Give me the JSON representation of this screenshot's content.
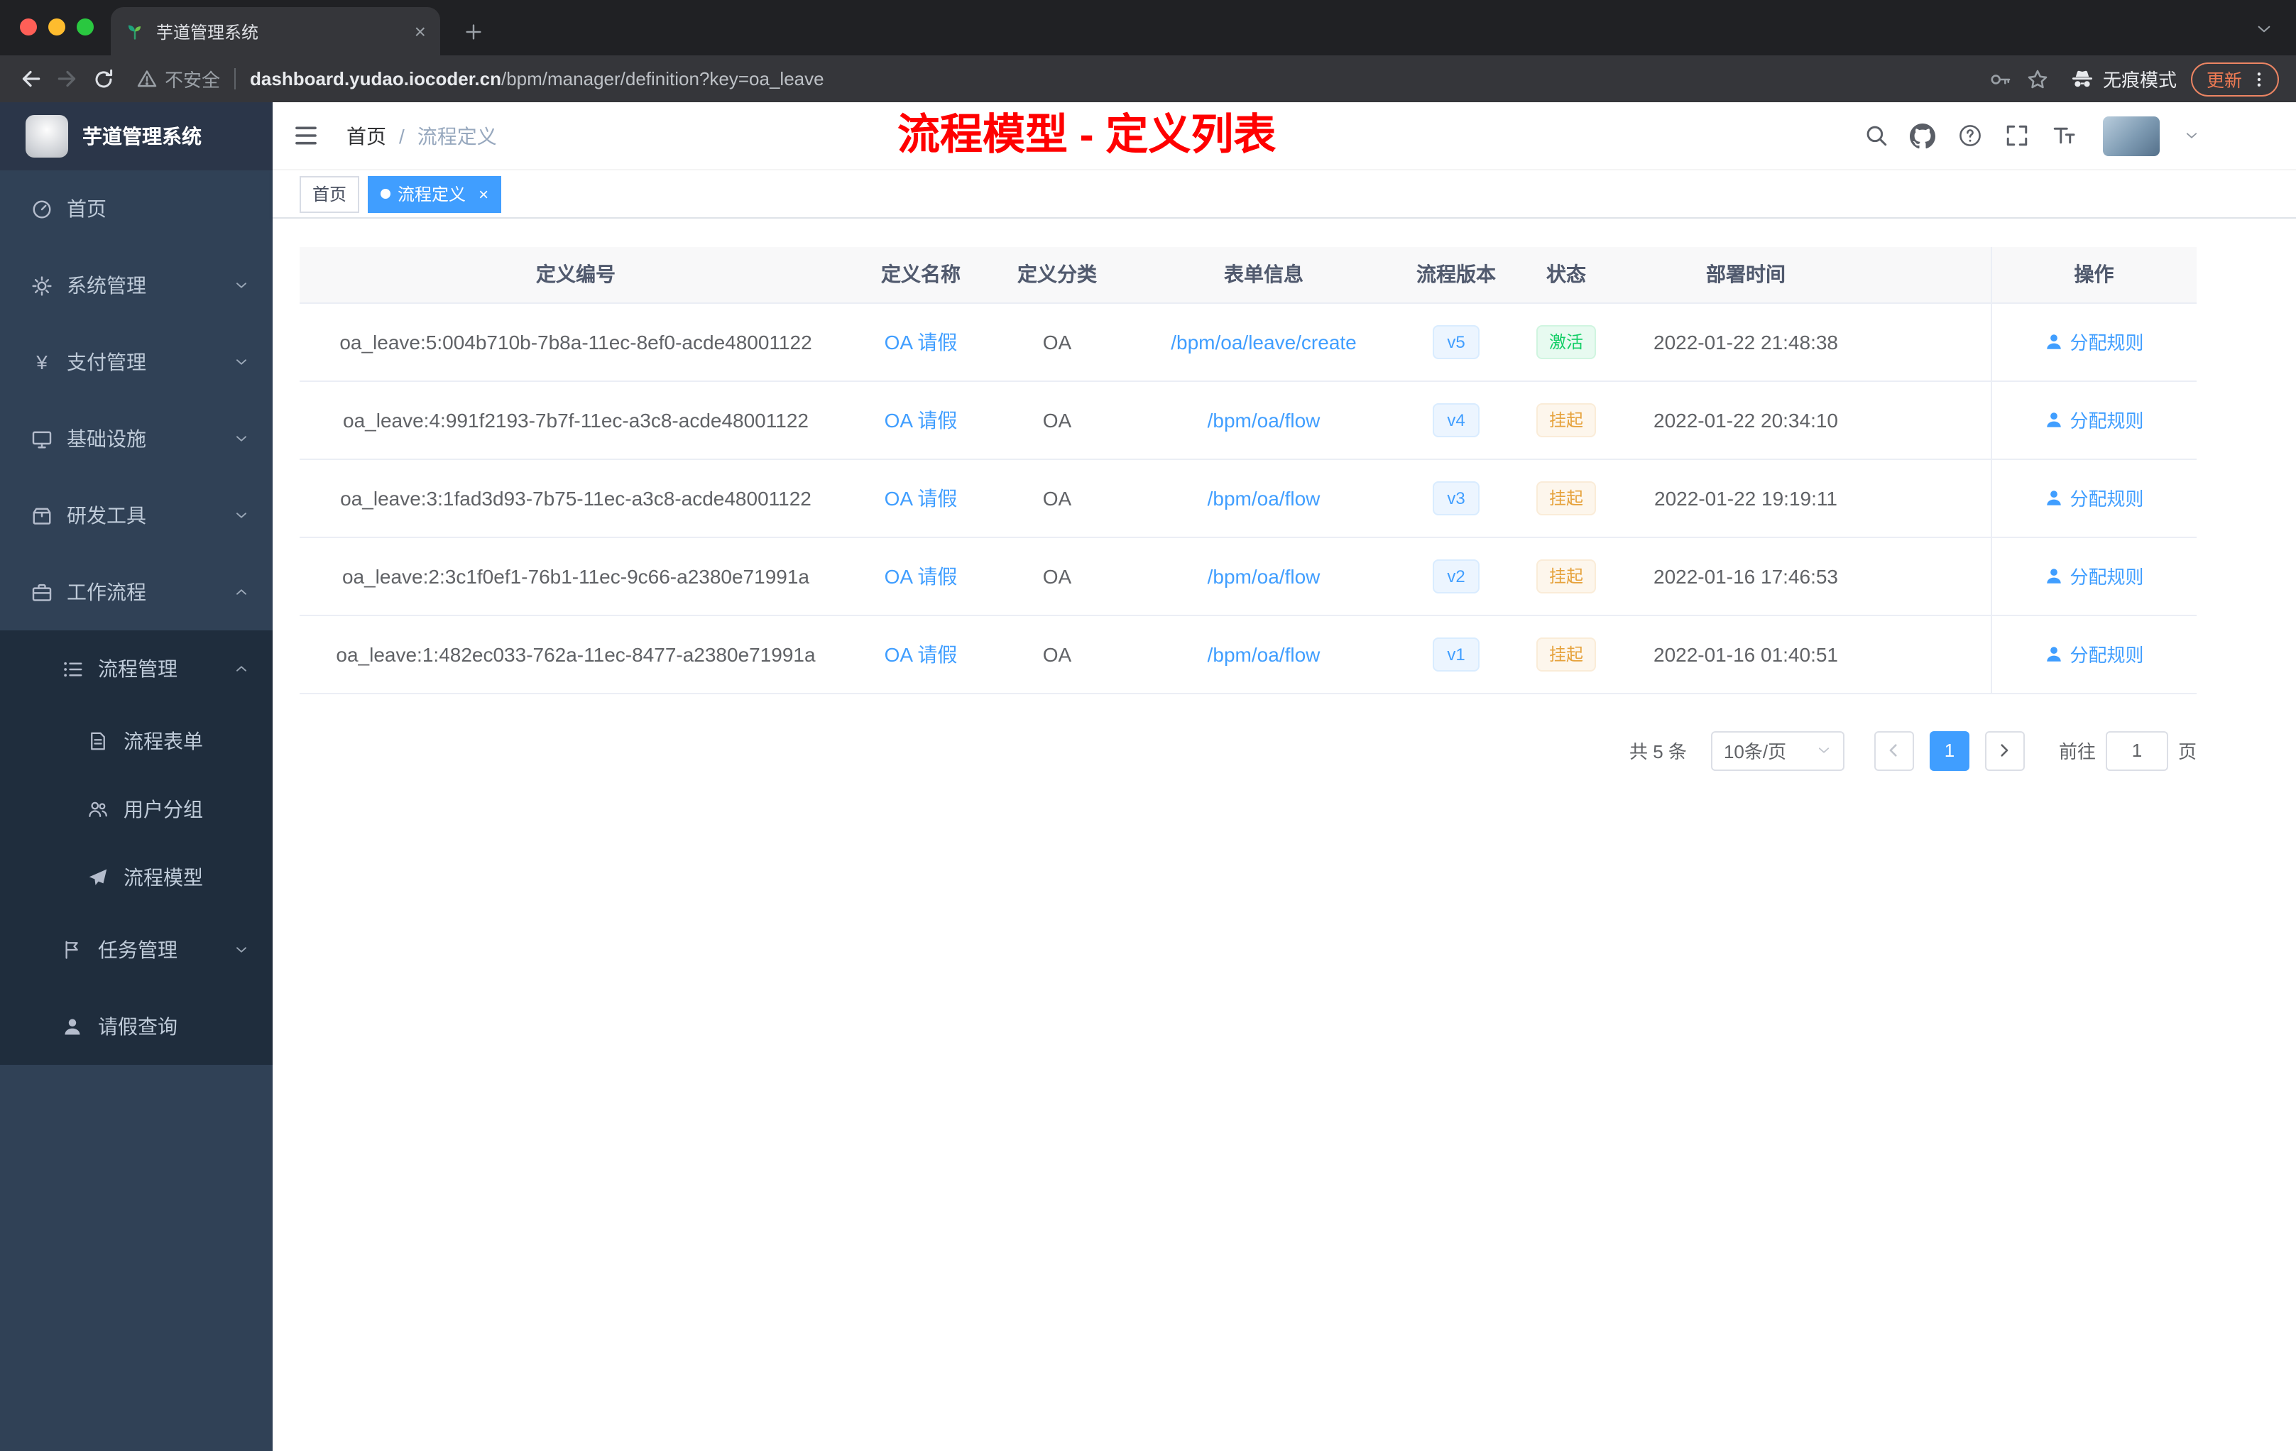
{
  "colors": {
    "accent_blue": "#409eff",
    "status_active_green": "#13ce66",
    "status_suspended_orange": "#e6a23c",
    "annotation_red": "#ff0000"
  },
  "browser": {
    "tab_title": "芋道管理系统",
    "tab_close": "×",
    "security_label": "不安全",
    "url_domain": "dashboard.yudao.iocoder.cn",
    "url_path": "/bpm/manager/definition?key=oa_leave",
    "incognito_label": "无痕模式",
    "update_label": "更新"
  },
  "sidebar": {
    "logo_title": "芋道管理系统",
    "items": [
      {
        "label": "首页"
      },
      {
        "label": "系统管理"
      },
      {
        "label": "支付管理"
      },
      {
        "label": "基础设施"
      },
      {
        "label": "研发工具"
      },
      {
        "label": "工作流程"
      },
      {
        "label": "流程管理"
      },
      {
        "label": "流程表单"
      },
      {
        "label": "用户分组"
      },
      {
        "label": "流程模型"
      },
      {
        "label": "任务管理"
      },
      {
        "label": "请假查询"
      }
    ]
  },
  "header": {
    "breadcrumb_home": "首页",
    "breadcrumb_separator": "/",
    "breadcrumb_current": "流程定义",
    "page_title": "流程模型 - 定义列表"
  },
  "tags": {
    "home": "首页",
    "active": "流程定义",
    "close": "×"
  },
  "table": {
    "columns": [
      "定义编号",
      "定义名称",
      "定义分类",
      "表单信息",
      "流程版本",
      "状态",
      "部署时间",
      "操作"
    ],
    "rows": [
      {
        "id": "oa_leave:5:004b710b-7b8a-11ec-8ef0-acde48001122",
        "name": "OA 请假",
        "category": "OA",
        "form": "/bpm/oa/leave/create",
        "version": "v5",
        "status": "激活",
        "deploy_time": "2022-01-22 21:48:38",
        "action": "分配规则"
      },
      {
        "id": "oa_leave:4:991f2193-7b7f-11ec-a3c8-acde48001122",
        "name": "OA 请假",
        "category": "OA",
        "form": "/bpm/oa/flow",
        "version": "v4",
        "status": "挂起",
        "deploy_time": "2022-01-22 20:34:10",
        "action": "分配规则"
      },
      {
        "id": "oa_leave:3:1fad3d93-7b75-11ec-a3c8-acde48001122",
        "name": "OA 请假",
        "category": "OA",
        "form": "/bpm/oa/flow",
        "version": "v3",
        "status": "挂起",
        "deploy_time": "2022-01-22 19:19:11",
        "action": "分配规则"
      },
      {
        "id": "oa_leave:2:3c1f0ef1-76b1-11ec-9c66-a2380e71991a",
        "name": "OA 请假",
        "category": "OA",
        "form": "/bpm/oa/flow",
        "version": "v2",
        "status": "挂起",
        "deploy_time": "2022-01-16 17:46:53",
        "action": "分配规则"
      },
      {
        "id": "oa_leave:1:482ec033-762a-11ec-8477-a2380e71991a",
        "name": "OA 请假",
        "category": "OA",
        "form": "/bpm/oa/flow",
        "version": "v1",
        "status": "挂起",
        "deploy_time": "2022-01-16 01:40:51",
        "action": "分配规则"
      }
    ]
  },
  "pagination": {
    "total": "共 5 条",
    "page_size": "10条/页",
    "current_page": "1",
    "goto_label": "前往",
    "goto_value": "1",
    "page_unit": "页"
  }
}
